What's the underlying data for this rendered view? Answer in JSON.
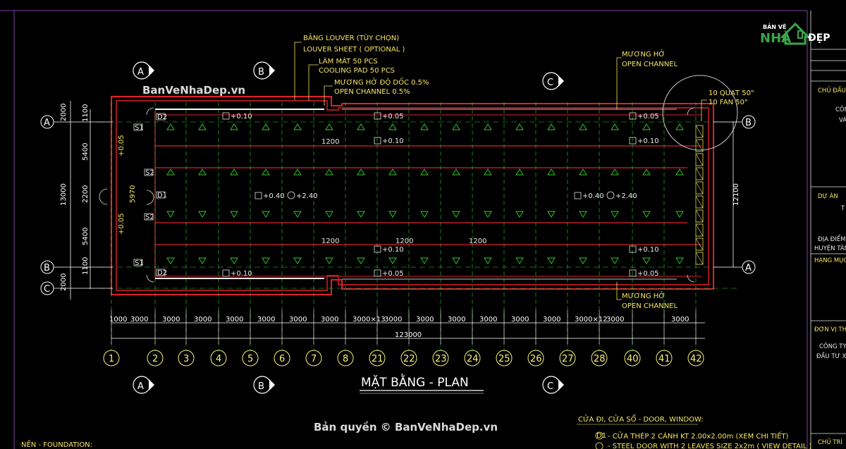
{
  "logo": {
    "line1": "BẢN VẼ",
    "brand_left": "NHÀ",
    "brand_right": "ĐẸP"
  },
  "watermarks": {
    "top": "BanVeNhaDep.vn",
    "bottom": "Bản quyền © BanVeNhaDep.vn"
  },
  "title": "MẶT BẰNG - PLAN",
  "annotations": {
    "louver_vi": "BẢNG LOUVER (TÙY CHỌN)",
    "louver_en": "LOUVER SHEET ( OPTIONAL )",
    "cooling_vi": "LÀM MÁT 50 PCS",
    "cooling_en": "COOLING PAD 50 PCS",
    "channel_slope_vi": "MƯƠNG HỞ ĐỘ DỐC 0.5%",
    "channel_slope_en": "OPEN CHANNEL 0.5%",
    "channel_top_vi": "MƯƠNG HỞ",
    "channel_top_en": "OPEN CHANNEL",
    "fan_vi": "10 QUẠT 50\"",
    "fan_en": "10 FAN 50\"",
    "channel_bottom_vi": "MƯƠNG HỞ",
    "channel_bottom_en": "OPEN CHANNEL"
  },
  "section_markers": {
    "a": "A",
    "b": "B",
    "c": "C"
  },
  "axis_rows": {
    "a": "A",
    "b": "B",
    "c": "C"
  },
  "left_dims": [
    "2000",
    "1100",
    "5400",
    "2200",
    "5400",
    "1100",
    "2000"
  ],
  "left_total": "13000",
  "right_total": "12100",
  "left_small": {
    "v1": "5970",
    "v2": "+0.05"
  },
  "bottom_dims": [
    "1000",
    "3000",
    "3000",
    "3000",
    "3000",
    "3000",
    "3000",
    "3000",
    "3000×13",
    "3000",
    "3000",
    "3000",
    "3000",
    "3000",
    "3000",
    "3000×12",
    "3000",
    "3000"
  ],
  "overall_length": "123000",
  "inner_dims": {
    "d1200_top": "1200",
    "d1200_bottom_left": "1200",
    "d1200_bottom_mid1": "1200",
    "d1200_bottom_mid2": "1200"
  },
  "levels": {
    "l010_top": "+0.10",
    "l005_top": "+0.05",
    "l005_right": "+0.05",
    "l010_mid_top": "+0.10",
    "l010_right_top": "+0.10",
    "l040_left": "+0.40",
    "l240_left": "+2.40",
    "l040_right": "+0.40",
    "l240_right": "+2.40",
    "l010_mid_bottom": "+0.10",
    "l010_right_bottom": "+0.10",
    "l010_bottom": "+0.10",
    "l005_bottom": "+0.05",
    "l005_bottom_right": "+0.05"
  },
  "door_tags": {
    "d1": "D1",
    "d2": "D2",
    "s1": "S1",
    "s2": "S2"
  },
  "grid_numbers": [
    "1",
    "2",
    "3",
    "4",
    "5",
    "6",
    "7",
    "8",
    "21",
    "22",
    "23",
    "24",
    "25",
    "26",
    "27",
    "28",
    "40",
    "41",
    "42"
  ],
  "legend": {
    "heading": "CỬA ĐI, CỬA SỔ - DOOR, WINDOW:",
    "item1": "- CỬA THÉP 2 CÁNH KT 2.00x2.00m (XEM CHI TIẾT)",
    "item2": "- STEEL DOOR WITH 2 LEAVES SIZE 2x2m ( VIEW DETAIL )",
    "item1_tag": "D1"
  },
  "foundation_label": "NỀN - FOUNDATION:",
  "title_block": {
    "chu_dau_tu": "CHỦ ĐẦU",
    "cong": "CÔN",
    "va": "VÀ",
    "du_an": "DỰ ÁN",
    "t": "T",
    "dia_diem": "ĐỊA ĐIỂM",
    "huyen": "HUYỆN TÂN",
    "hang_muc": "HẠNG MỤC",
    "don_vi": "ĐƠN VỊ THI",
    "cong_ty": "CÔNG TY",
    "dau_tu": "ĐẦU TƯ XÂ",
    "chu_tri": "CHỦ TRÌ"
  },
  "colors": {
    "background": "#000000",
    "wall_red": "#e0202a",
    "dim_white": "#ffffff",
    "grid_green": "#33cc33",
    "annot_yellow": "#f5e663",
    "marker_white": "#ffffff",
    "purple_frame": "#7a3fa8"
  }
}
